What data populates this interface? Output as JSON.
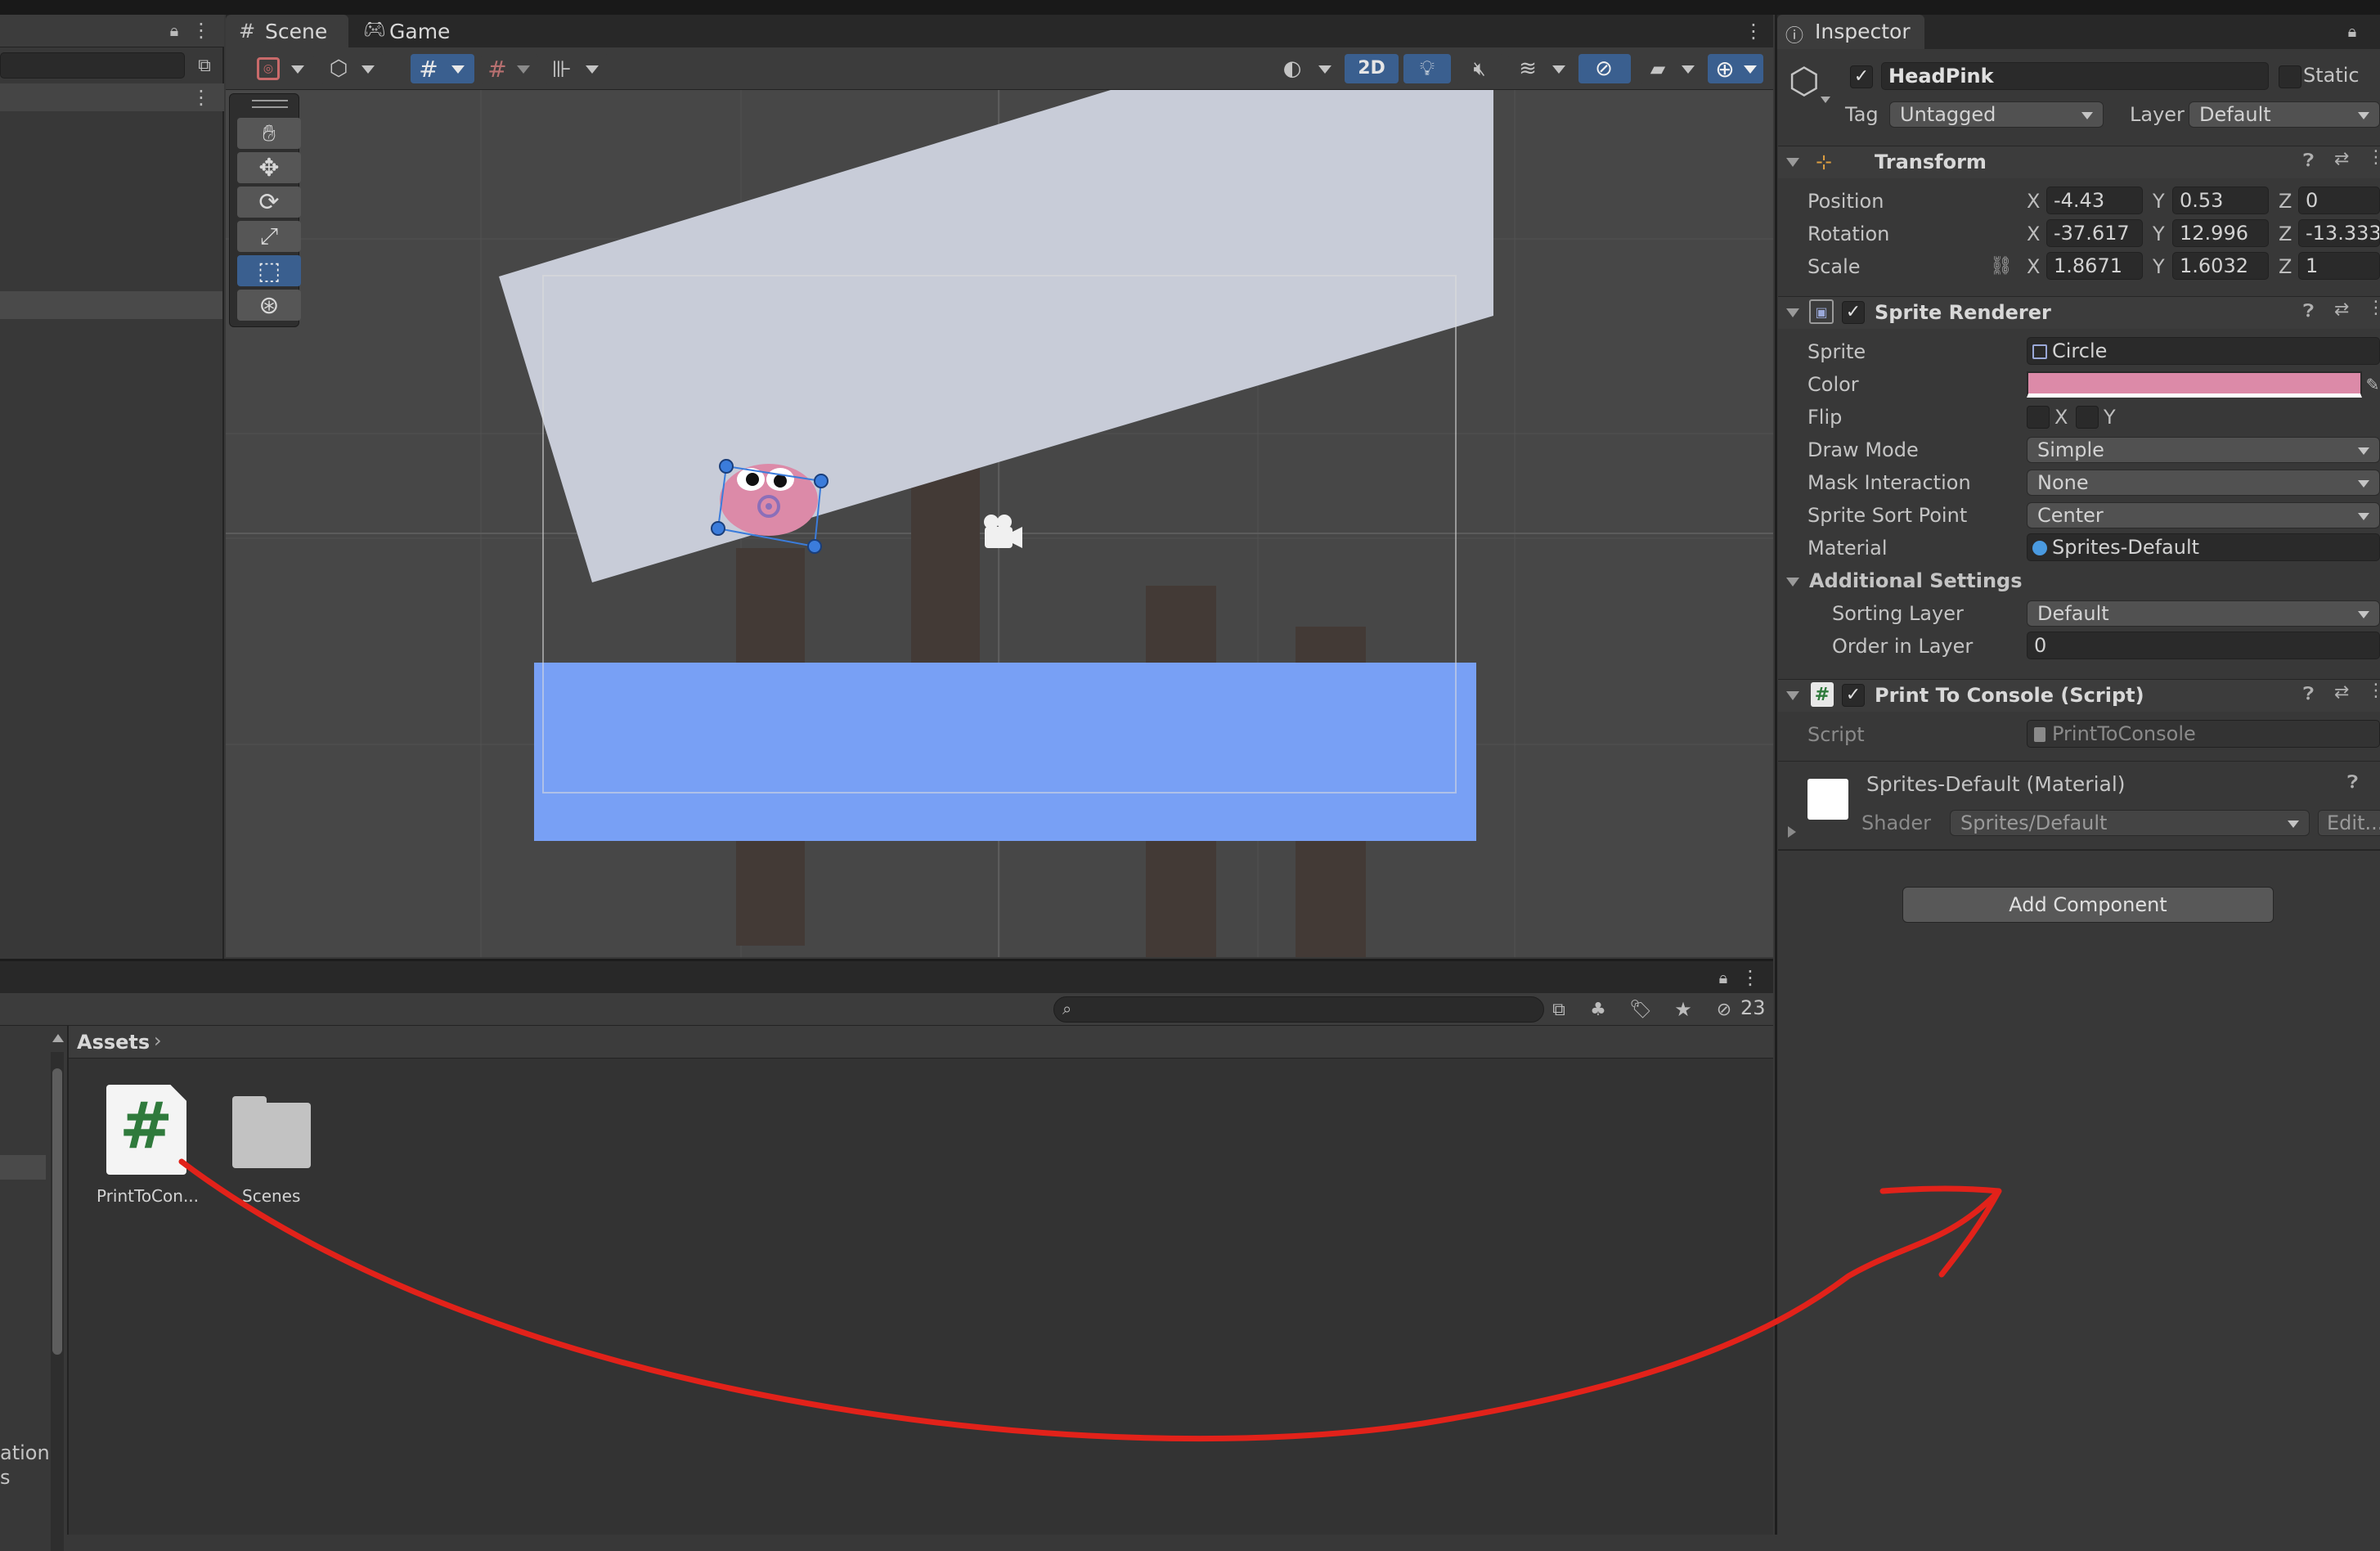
{
  "scene_tabs": {
    "scene": "Scene",
    "game": "Game"
  },
  "scene_toolbar": {
    "mode_2d": "2D"
  },
  "inspector": {
    "tab_label": "Inspector",
    "object_name": "HeadPink",
    "static_label": "Static",
    "tag_label": "Tag",
    "tag_value": "Untagged",
    "layer_label": "Layer",
    "layer_value": "Default",
    "transform": {
      "title": "Transform",
      "position_label": "Position",
      "position": {
        "x": "-4.43",
        "y": "0.53",
        "z": "0"
      },
      "rotation_label": "Rotation",
      "rotation": {
        "x": "-37.617",
        "y": "12.996",
        "z": "-13.333"
      },
      "scale_label": "Scale",
      "scale": {
        "x": "1.8671",
        "y": "1.6032",
        "z": "1"
      },
      "axis_x": "X",
      "axis_y": "Y",
      "axis_z": "Z"
    },
    "sprite_renderer": {
      "title": "Sprite Renderer",
      "sprite_label": "Sprite",
      "sprite_value": "Circle",
      "color_label": "Color",
      "color_value": "#dc8aa8",
      "flip_label": "Flip",
      "flip_x": "X",
      "flip_y": "Y",
      "draw_mode_label": "Draw Mode",
      "draw_mode_value": "Simple",
      "mask_label": "Mask Interaction",
      "mask_value": "None",
      "sort_point_label": "Sprite Sort Point",
      "sort_point_value": "Center",
      "material_label": "Material",
      "material_value": "Sprites-Default",
      "additional_label": "Additional Settings",
      "sorting_layer_label": "Sorting Layer",
      "sorting_layer_value": "Default",
      "order_label": "Order in Layer",
      "order_value": "0"
    },
    "print_script": {
      "title": "Print To Console (Script)",
      "script_label": "Script",
      "script_value": "PrintToConsole"
    },
    "material": {
      "title": "Sprites-Default (Material)",
      "shader_label": "Shader",
      "shader_value": "Sprites/Default",
      "edit_label": "Edit..."
    },
    "add_component": "Add Component"
  },
  "project": {
    "breadcrumb": "Assets",
    "hidden_count": "23",
    "items": [
      {
        "name": "PrintToCon...",
        "type": "script"
      },
      {
        "name": "Scenes",
        "type": "folder"
      }
    ],
    "left_fragment_1": "ation",
    "left_fragment_2": "s"
  },
  "colors": {
    "bg_panel": "#383838",
    "scene_bg": "#474747",
    "accent_blue": "#3a5f8f",
    "water": "#78a0f5",
    "sky_block": "#c8ccd8",
    "pink": "#dc8aa8",
    "arrow": "#e2221a"
  }
}
